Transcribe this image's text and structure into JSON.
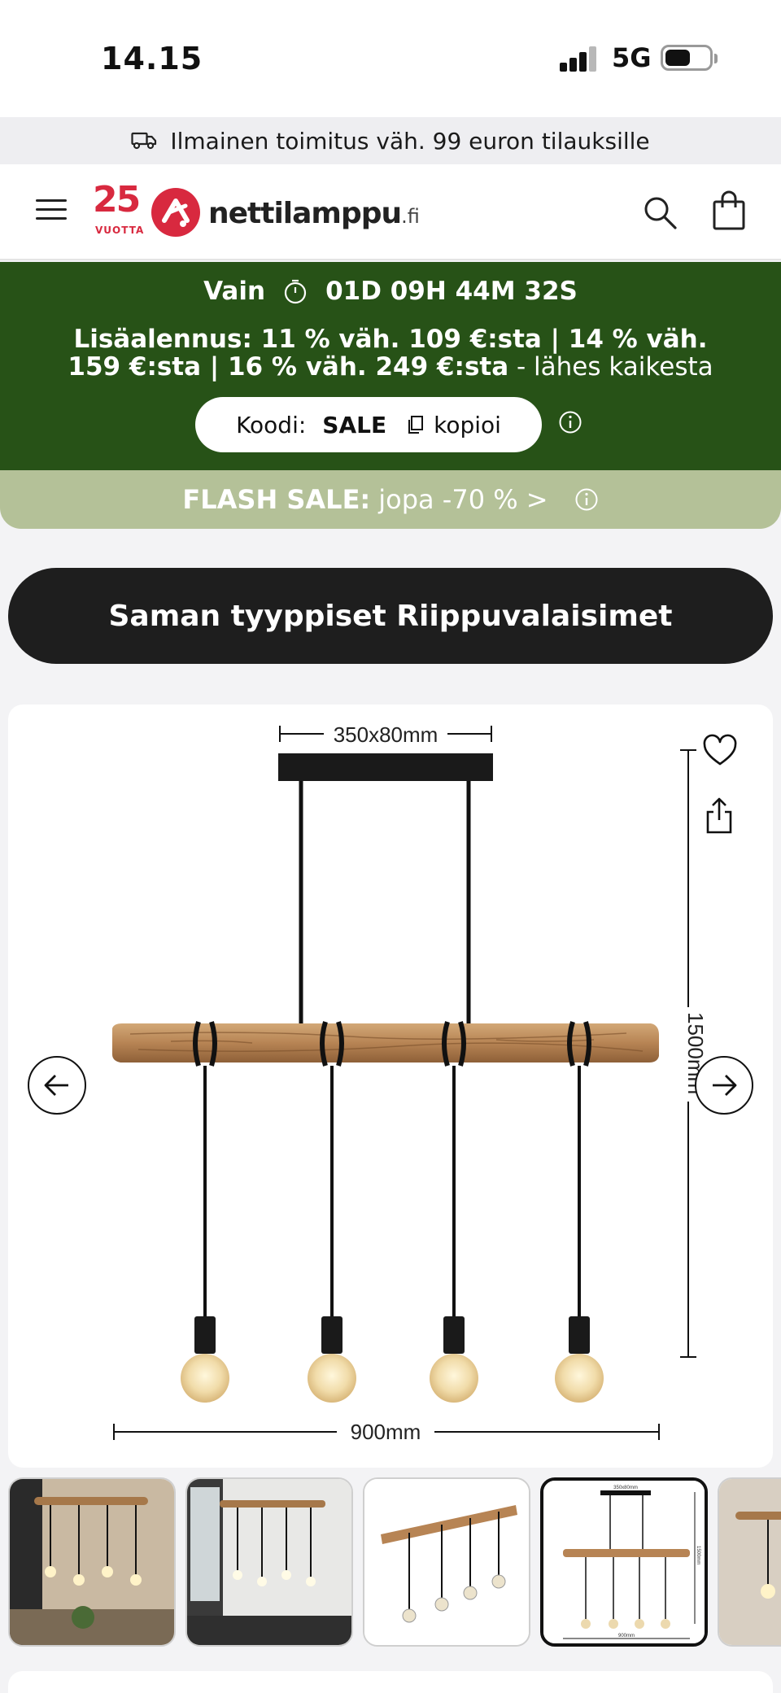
{
  "status_bar": {
    "time": "14.15",
    "network": "5G"
  },
  "shipping_banner": {
    "icon": "truck-icon",
    "text": "Ilmainen toimitus väh. 99 euron tilauksille"
  },
  "header": {
    "logo_years": "25",
    "logo_years_sub": "VUOTTA",
    "logo_name": "nettilamppu",
    "logo_tld": ".fi",
    "brand_color": "#d8293f"
  },
  "promo": {
    "background": "#275217",
    "timer_prefix": "Vain",
    "timer": "01D 09H 44M 32S",
    "discount_bold": "Lisäalennus: 11 % väh. 109 €:sta | 14 % väh. 159 €:sta | 16 % väh. 249 €:sta",
    "discount_light": " - lähes kaikesta",
    "code_label": "Koodi:",
    "code": "SALE",
    "copy_label": "kopioi"
  },
  "flash_sale": {
    "label": "FLASH SALE:",
    "text": "jopa -70 % >"
  },
  "similar_button": {
    "label": "Saman tyyppiset Riippuvalaisimet"
  },
  "product_image": {
    "dim_top": "350x80mm",
    "dim_height": "1500mm",
    "dim_width": "900mm"
  },
  "thumbnails": {
    "count_visible": 5,
    "active_index": 3,
    "thumb4_top": "350x80mm",
    "thumb4_height": "1500mm",
    "thumb4_width": "900mm"
  }
}
